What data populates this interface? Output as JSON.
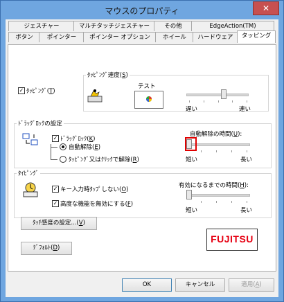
{
  "window": {
    "title": "マウスのプロパティ",
    "close": "✕"
  },
  "tabs_row1": [
    "ジェスチャー",
    "マルチタッチジェスチャー",
    "その他",
    "EdgeAction(TM)"
  ],
  "tabs_row2": [
    "ボタン",
    "ポインター",
    "ポインター オプション",
    "ホイール",
    "ハードウェア",
    "タッピング"
  ],
  "tapping": {
    "enable_label": "ﾀｯﾋﾟﾝｸﾞ(",
    "enable_key": "T",
    "enable_end": ")",
    "speed_label": "ﾀｯﾋﾟﾝｸﾞ速度(",
    "speed_key": "S",
    "speed_end": ")",
    "test_label": "テスト",
    "slow": "遅い",
    "fast": "速い",
    "speed_value": 0.62
  },
  "dragging": {
    "group_label": "ﾄﾞﾗｯｸﾞﾛｯｸの設定",
    "lock_label": "ﾄﾞﾗｯｸﾞﾛｯｸ(",
    "lock_key": "K",
    "lock_end": ")",
    "auto_label": "自動解除(",
    "auto_key": "E",
    "auto_end": ")",
    "tap_label": "ﾀｯﾋﾟﾝｸﾞ又はｸﾘｯｸで解除(",
    "tap_key": "R",
    "tap_end": ")",
    "time_label": "自動解除の時間(",
    "time_key": "U",
    "time_end": "):",
    "short": "短い",
    "long": "長い",
    "time_value": 0.0
  },
  "typing": {
    "group_label": "ﾀｲﾋﾟﾝｸﾞ",
    "key_input_label": "キー入力時ﾀｯﾌﾟしない(",
    "key_input_key": "O",
    "key_input_end": ")",
    "adv_label": "高度な機能を無効にする(",
    "adv_key": "F",
    "adv_end": ")",
    "enable_time_label": "有効になるまでの時間(",
    "enable_time_key": "H",
    "enable_time_end": "):",
    "short": "短い",
    "long": "長い",
    "time_value": 0.0
  },
  "buttons": {
    "sensitivity": "ﾀｯﾁ感度の設定...(",
    "sensitivity_key": "V",
    "sensitivity_end": ")",
    "default": "ﾃﾞﾌｫﾙﾄ(",
    "default_key": "D",
    "default_end": ")",
    "ok": "OK",
    "cancel": "キャンセル",
    "apply": "適用(",
    "apply_key": "A",
    "apply_end": ")"
  },
  "logo": {
    "text": "FUJITSU"
  },
  "checkmark": "✓"
}
